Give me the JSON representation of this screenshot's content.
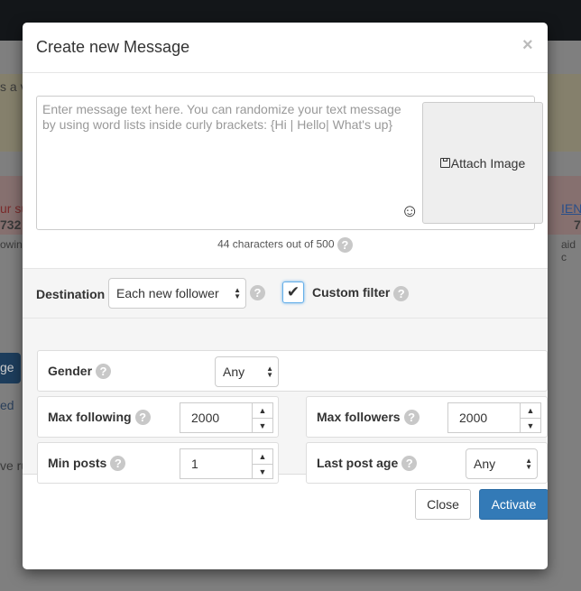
{
  "background": {
    "fragments": [
      "s a v",
      "ur su",
      "IEN",
      "732",
      "owing",
      "7",
      "aid c",
      "ge",
      "ed",
      "ve ru"
    ]
  },
  "modal": {
    "title": "Create new Message",
    "close_glyph": "×",
    "message": {
      "placeholder": "Enter message text here. You can randomize your text message by using word lists inside curly brackets: {Hi | Hello| What's up}",
      "value": ""
    },
    "emoji_glyph": "☺",
    "attach_label": "Attach Image",
    "attach_icon": "floppy-disk-icon",
    "char_count": "44 characters out of 500",
    "help_glyph": "?",
    "destination": {
      "label": "Destination",
      "value": "Each new follower"
    },
    "custom_filter": {
      "label": "Custom filter",
      "checked": true,
      "glyph": "✔"
    },
    "filters": {
      "gender": {
        "label": "Gender",
        "value": "Any"
      },
      "max_following": {
        "label": "Max following",
        "value": "2000"
      },
      "max_followers": {
        "label": "Max followers",
        "value": "2000"
      },
      "min_posts": {
        "label": "Min posts",
        "value": "1"
      },
      "last_post_age": {
        "label": "Last post age",
        "value": "Any"
      }
    },
    "footer": {
      "close": "Close",
      "activate": "Activate"
    },
    "colors": {
      "primary": "#337ab7"
    }
  }
}
